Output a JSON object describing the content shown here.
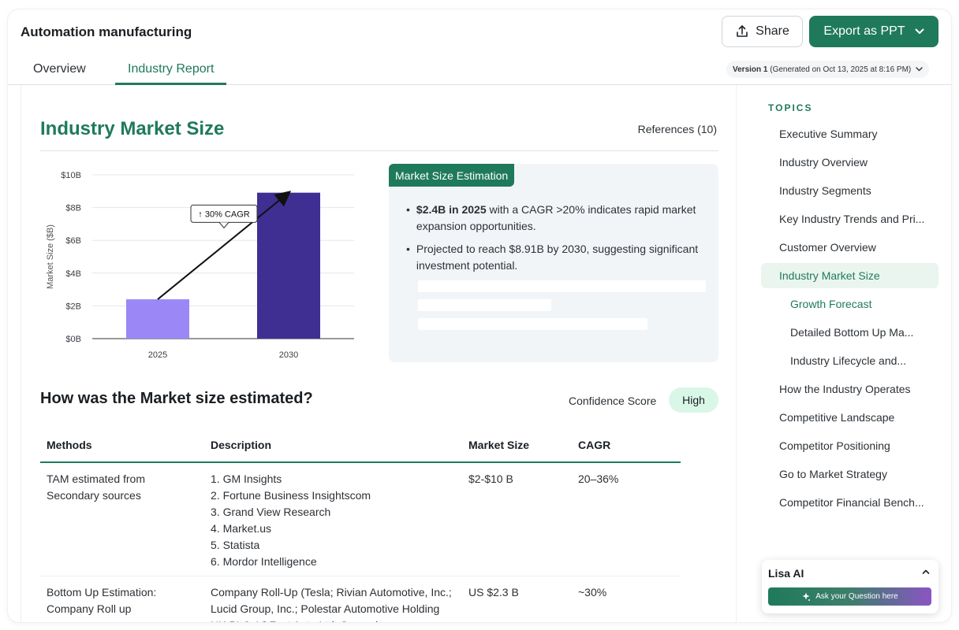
{
  "header": {
    "title": "Automation manufacturing",
    "share_label": "Share",
    "export_label": "Export as PPT"
  },
  "tabs": [
    {
      "label": "Overview",
      "active": false
    },
    {
      "label": "Industry Report",
      "active": true
    }
  ],
  "version": {
    "label": "Version 1",
    "generated": "(Generated on Oct 13, 2025 at 8:16 PM)"
  },
  "section": {
    "title": "Industry Market Size",
    "references": "References (10)"
  },
  "chart_data": {
    "type": "bar",
    "categories": [
      "2025",
      "2030"
    ],
    "values": [
      2.4,
      8.91
    ],
    "ylabel": "Market Size ($B)",
    "yticks": [
      "$0B",
      "$2B",
      "$4B",
      "$6B",
      "$8B",
      "$10B"
    ],
    "ylim": [
      0,
      10
    ],
    "grid": true,
    "annotation": "↑ 30% CAGR",
    "colors": [
      "#9b87f5",
      "#3f2f93"
    ]
  },
  "estimate": {
    "tag": "Market Size Estimation",
    "bullet1_bold": "$2.4B in 2025",
    "bullet1_rest": " with a CAGR >20% indicates rapid market expansion opportunities.",
    "bullet2": "Projected to reach $8.91B by 2030, suggesting significant investment potential."
  },
  "estimation": {
    "title": "How was the Market size estimated?",
    "confidence_label": "Confidence Score",
    "confidence_value": "High"
  },
  "table": {
    "headers": [
      "Methods",
      "Description",
      "Market Size",
      "CAGR"
    ],
    "rows": [
      {
        "method": "TAM estimated from Secondary sources",
        "description_items": [
          "1. GM Insights",
          "2. Fortune Business Insightscom",
          "3. Grand View Research",
          "4. Market.us",
          "5. Statista",
          "6. Mordor Intelligence"
        ],
        "size": "$2-$10 B",
        "cagr": "20–36%"
      },
      {
        "method": "Bottom Up Estimation: Company Roll up",
        "description": "Company Roll-Up (Tesla; Rivian Automotive, Inc.; Lucid Group, Inc.; Polestar Automotive Holding UK PLC; Vi Fast Auto Ltd; Several",
        "size": "US $2.3 B",
        "cagr": "~30%"
      }
    ]
  },
  "sidebar": {
    "label": "TOPICS",
    "items": [
      {
        "label": "Executive Summary",
        "level": 1
      },
      {
        "label": "Industry Overview",
        "level": 1
      },
      {
        "label": "Industry Segments",
        "level": 1
      },
      {
        "label": "Key Industry Trends and Pri...",
        "level": 1
      },
      {
        "label": "Customer Overview",
        "level": 1
      },
      {
        "label": "Industry Market Size",
        "level": 1,
        "active": true
      },
      {
        "label": "Growth Forecast",
        "level": 2,
        "active": true
      },
      {
        "label": "Detailed Bottom Up Ma...",
        "level": 2
      },
      {
        "label": "Industry Lifecycle and...",
        "level": 2
      },
      {
        "label": "How the Industry Operates",
        "level": 1
      },
      {
        "label": "Competitive Landscape",
        "level": 1
      },
      {
        "label": "Competitor Positioning",
        "level": 1
      },
      {
        "label": "Go to Market Strategy",
        "level": 1
      },
      {
        "label": "Competitor Financial Bench...",
        "level": 1
      }
    ]
  },
  "lisa": {
    "title": "Lisa AI",
    "placeholder": "Ask your Question here"
  }
}
